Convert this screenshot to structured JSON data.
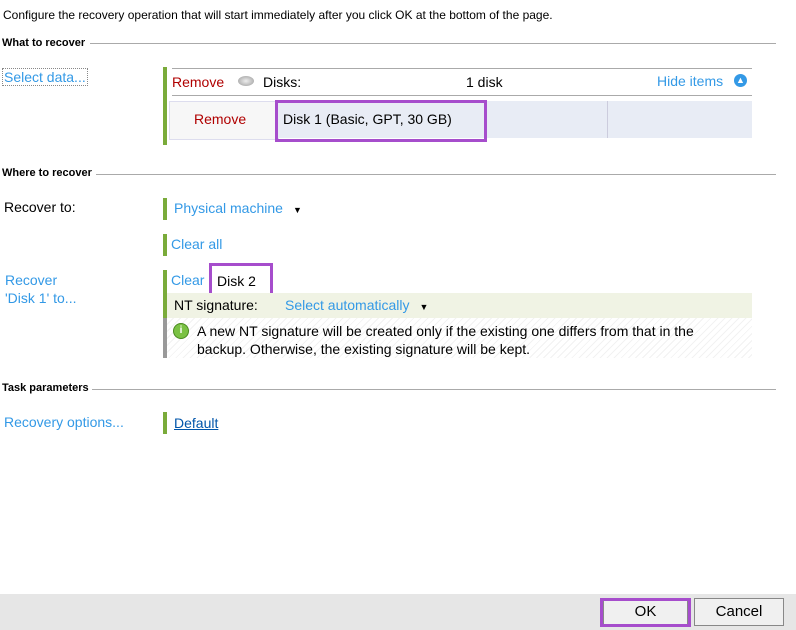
{
  "intro": "Configure the recovery operation that will start immediately after you click OK at the bottom of the page.",
  "what": {
    "title": "What to recover",
    "select_data": "Select data...",
    "remove": "Remove",
    "disks_label": "Disks:",
    "disk_count": "1 disk",
    "hide_items": "Hide items",
    "item_remove": "Remove",
    "item": "Disk 1 (Basic, GPT, 30 GB)"
  },
  "where": {
    "title": "Where to recover",
    "recover_to_label": "Recover to:",
    "recover_to_value": "Physical machine",
    "clear_all": "Clear all",
    "recover_disk_label_1": "Recover",
    "recover_disk_label_2": "'Disk 1' to...",
    "clear": "Clear",
    "target": "Disk 2",
    "nt_label": "NT signature:",
    "nt_value": "Select automatically",
    "info_1": "A new NT signature will be created only if the existing one differs from that in the",
    "info_2": "backup. Otherwise, the existing signature will be kept."
  },
  "task": {
    "title": "Task parameters",
    "options_label": "Recovery options...",
    "options_value": "Default"
  },
  "footer": {
    "ok": "OK",
    "cancel": "Cancel"
  }
}
